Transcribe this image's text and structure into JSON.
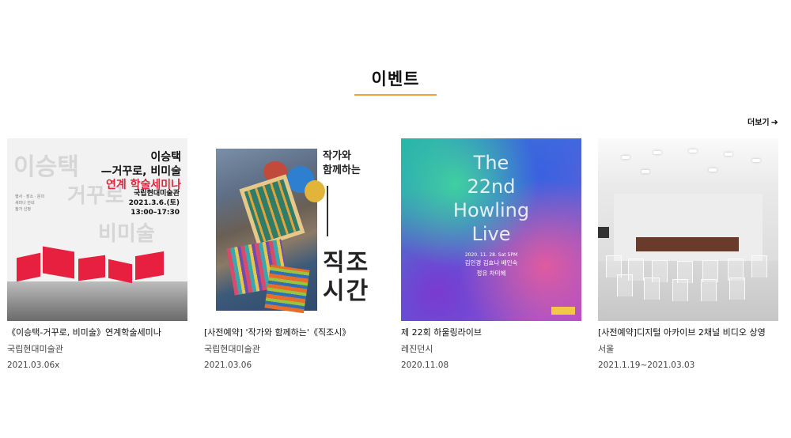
{
  "section": {
    "title": "이벤트"
  },
  "more": {
    "label": "더보기",
    "arrow": "➜"
  },
  "events": [
    {
      "title": "《이승택-거꾸로, 비미술》연계학술세미나",
      "place": "국립현대미술관",
      "date": "2021.03.06x",
      "poster": {
        "ghost1": "이승택",
        "ghost2": "거꾸로",
        "ghost3": "비미술",
        "heading_line1": "이승택",
        "heading_line2": "—거꾸로, 비미술",
        "heading_line3": "연계 학술세미나",
        "org": "국립현대미술관",
        "when": "2021.3.6.(토)",
        "time": "13:00–17:30",
        "accent": "#e0253f"
      }
    },
    {
      "title": "[사전예약] '작가와 함께하는'《직조시》",
      "place": "국립현대미술관",
      "date": "2021.03.06",
      "poster": {
        "small_line1": "작가와",
        "small_line2": "함께하는",
        "big_line1": "직조",
        "big_line2": "시간"
      }
    },
    {
      "title": "제 22회 하울링라이브",
      "place": "레진던시",
      "date": "2020.11.08",
      "poster": {
        "line1": "The",
        "line2": "22nd",
        "line3": "Howling",
        "line4": "Live",
        "date": "2020. 11. 28. Sat 5PM",
        "names_line1": "김인경 김효나 배인숙",
        "names_line2": "정유 차미혜"
      }
    },
    {
      "title": "[사전예약]디지털 아카이브 2채널 비디오 상영",
      "place": "서울",
      "date": "2021.1.19~2021.03.03",
      "poster": {}
    }
  ],
  "colors": {
    "title_underline": "#f0a33a"
  }
}
